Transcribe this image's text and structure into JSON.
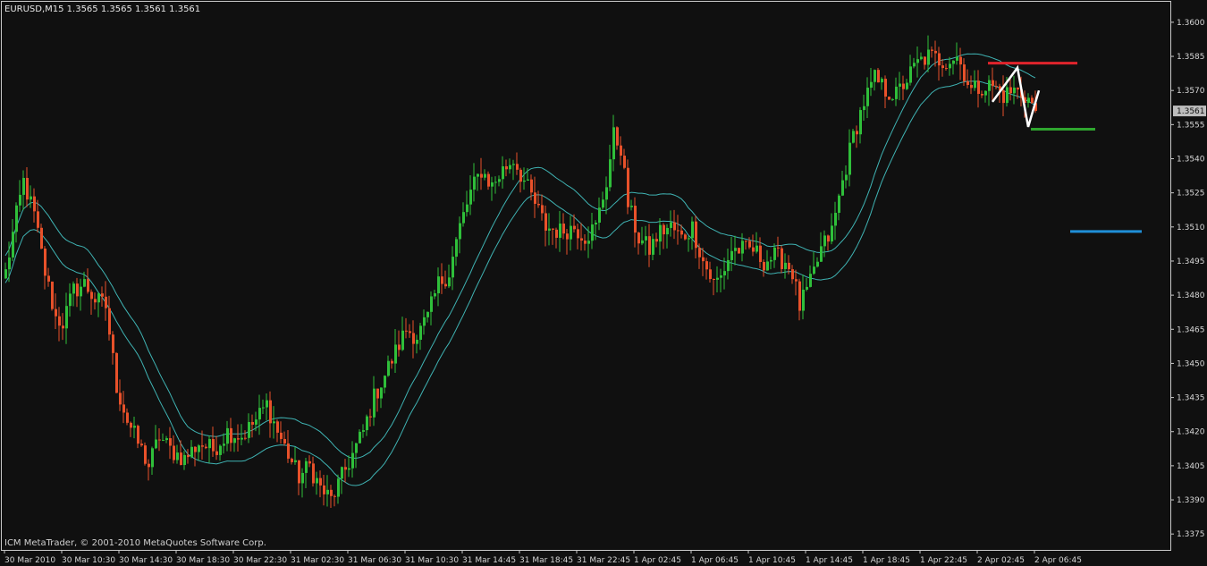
{
  "header": {
    "symbol_line": "EURUSD,M15  1.3565 1.3565 1.3561 1.3561"
  },
  "footer": {
    "copyright": "ICM MetaTrader, © 2001-2010 MetaQuotes Software Corp."
  },
  "colors": {
    "background": "#101010",
    "frame": "#c8c8c8",
    "bull": "#2fbf3a",
    "bear": "#e8512a",
    "ma": "#3fb3b3",
    "zigzag": "#ffffff",
    "resistance": "#e0242c",
    "support": "#2fa62f",
    "target": "#1f8fd8",
    "current_label_bg": "#bdbdbd"
  },
  "chart_data": {
    "type": "candlestick",
    "symbol": "EURUSD",
    "timeframe": "M15",
    "last_ohlc": {
      "open": 1.3565,
      "high": 1.3565,
      "low": 1.3561,
      "close": 1.3561
    },
    "current_price": 1.3561,
    "current_price_label": "1.3561",
    "ylim": [
      1.3368,
      1.3609
    ],
    "y_ticks": [
      {
        "value": 1.36,
        "label": "1.3600"
      },
      {
        "value": 1.3585,
        "label": "1.3585"
      },
      {
        "value": 1.357,
        "label": "1.3570"
      },
      {
        "value": 1.3555,
        "label": "1.3555"
      },
      {
        "value": 1.354,
        "label": "1.3540"
      },
      {
        "value": 1.3525,
        "label": "1.3525"
      },
      {
        "value": 1.351,
        "label": "1.3510"
      },
      {
        "value": 1.3495,
        "label": "1.3495"
      },
      {
        "value": 1.348,
        "label": "1.3480"
      },
      {
        "value": 1.3465,
        "label": "1.3465"
      },
      {
        "value": 1.345,
        "label": "1.3450"
      },
      {
        "value": 1.3435,
        "label": "1.3435"
      },
      {
        "value": 1.342,
        "label": "1.3420"
      },
      {
        "value": 1.3405,
        "label": "1.3405"
      },
      {
        "value": 1.339,
        "label": "1.3390"
      },
      {
        "value": 1.3375,
        "label": "1.3375"
      }
    ],
    "x_ticks": [
      "30 Mar 2010",
      "30 Mar 10:30",
      "30 Mar 14:30",
      "30 Mar 18:30",
      "30 Mar 22:30",
      "31 Mar 02:30",
      "31 Mar 06:30",
      "31 Mar 10:30",
      "31 Mar 14:45",
      "31 Mar 18:45",
      "31 Mar 22:45",
      "1 Apr 02:45",
      "1 Apr 06:45",
      "1 Apr 10:45",
      "1 Apr 14:45",
      "1 Apr 18:45",
      "1 Apr 22:45",
      "2 Apr 02:45",
      "2 Apr 06:45"
    ],
    "bars_per_tick": 16,
    "price_path": [
      [
        0,
        1.349
      ],
      [
        3,
        1.3515
      ],
      [
        5,
        1.353
      ],
      [
        8,
        1.3515
      ],
      [
        11,
        1.349
      ],
      [
        14,
        1.347
      ],
      [
        16,
        1.3468
      ],
      [
        19,
        1.3482
      ],
      [
        22,
        1.3485
      ],
      [
        25,
        1.3478
      ],
      [
        28,
        1.3475
      ],
      [
        31,
        1.344
      ],
      [
        34,
        1.3425
      ],
      [
        37,
        1.3415
      ],
      [
        40,
        1.3405
      ],
      [
        43,
        1.3418
      ],
      [
        46,
        1.3412
      ],
      [
        50,
        1.3408
      ],
      [
        54,
        1.3415
      ],
      [
        58,
        1.3412
      ],
      [
        62,
        1.342
      ],
      [
        66,
        1.3418
      ],
      [
        70,
        1.3425
      ],
      [
        73,
        1.3432
      ],
      [
        76,
        1.342
      ],
      [
        79,
        1.341
      ],
      [
        82,
        1.34
      ],
      [
        85,
        1.3405
      ],
      [
        88,
        1.3395
      ],
      [
        91,
        1.339
      ],
      [
        94,
        1.34
      ],
      [
        97,
        1.341
      ],
      [
        100,
        1.342
      ],
      [
        103,
        1.3435
      ],
      [
        106,
        1.3445
      ],
      [
        109,
        1.3455
      ],
      [
        112,
        1.3465
      ],
      [
        115,
        1.3462
      ],
      [
        118,
        1.347
      ],
      [
        121,
        1.3485
      ],
      [
        124,
        1.349
      ],
      [
        127,
        1.351
      ],
      [
        130,
        1.3525
      ],
      [
        133,
        1.3535
      ],
      [
        136,
        1.3528
      ],
      [
        139,
        1.3535
      ],
      [
        142,
        1.354
      ],
      [
        145,
        1.353
      ],
      [
        148,
        1.352
      ],
      [
        151,
        1.351
      ],
      [
        155,
        1.3508
      ],
      [
        159,
        1.351
      ],
      [
        162,
        1.3506
      ],
      [
        165,
        1.351
      ],
      [
        168,
        1.353
      ],
      [
        170,
        1.355
      ],
      [
        172,
        1.3545
      ],
      [
        174,
        1.352
      ],
      [
        177,
        1.3505
      ],
      [
        180,
        1.35
      ],
      [
        183,
        1.3508
      ],
      [
        186,
        1.351
      ],
      [
        189,
        1.3505
      ],
      [
        192,
        1.351
      ],
      [
        195,
        1.3495
      ],
      [
        198,
        1.3485
      ],
      [
        200,
        1.3488
      ],
      [
        203,
        1.35
      ],
      [
        206,
        1.35
      ],
      [
        209,
        1.35
      ],
      [
        212,
        1.3495
      ],
      [
        215,
        1.3497
      ],
      [
        218,
        1.3495
      ],
      [
        220,
        1.349
      ],
      [
        222,
        1.3475
      ],
      [
        225,
        1.3485
      ],
      [
        228,
        1.35
      ],
      [
        231,
        1.3508
      ],
      [
        234,
        1.353
      ],
      [
        237,
        1.355
      ],
      [
        240,
        1.3565
      ],
      [
        243,
        1.3575
      ],
      [
        246,
        1.357
      ],
      [
        249,
        1.3568
      ],
      [
        252,
        1.3575
      ],
      [
        255,
        1.3582
      ],
      [
        258,
        1.3585
      ],
      [
        262,
        1.3583
      ],
      [
        266,
        1.3585
      ],
      [
        268,
        1.3578
      ],
      [
        270,
        1.357
      ],
      [
        273,
        1.3572
      ],
      [
        276,
        1.3572
      ],
      [
        279,
        1.3568
      ],
      [
        282,
        1.357
      ],
      [
        285,
        1.3568
      ],
      [
        288,
        1.3562
      ]
    ],
    "moving_averages": [
      {
        "period": 21,
        "offset": 0.0006
      },
      {
        "period": 21,
        "offset": -0.0006
      }
    ],
    "zigzag": [
      {
        "bar": 276,
        "price": 1.3565
      },
      {
        "bar": 283,
        "price": 1.358
      },
      {
        "bar": 286,
        "price": 1.3554
      },
      {
        "bar": 289,
        "price": 1.357
      }
    ],
    "levels": [
      {
        "name": "resistance",
        "price": 1.3582,
        "from_bar": 275,
        "to_bar": 300
      },
      {
        "name": "support",
        "price": 1.3553,
        "from_bar": 287,
        "to_bar": 305
      },
      {
        "name": "target",
        "price": 1.3508,
        "from_bar": 298,
        "to_bar": 318
      }
    ]
  }
}
